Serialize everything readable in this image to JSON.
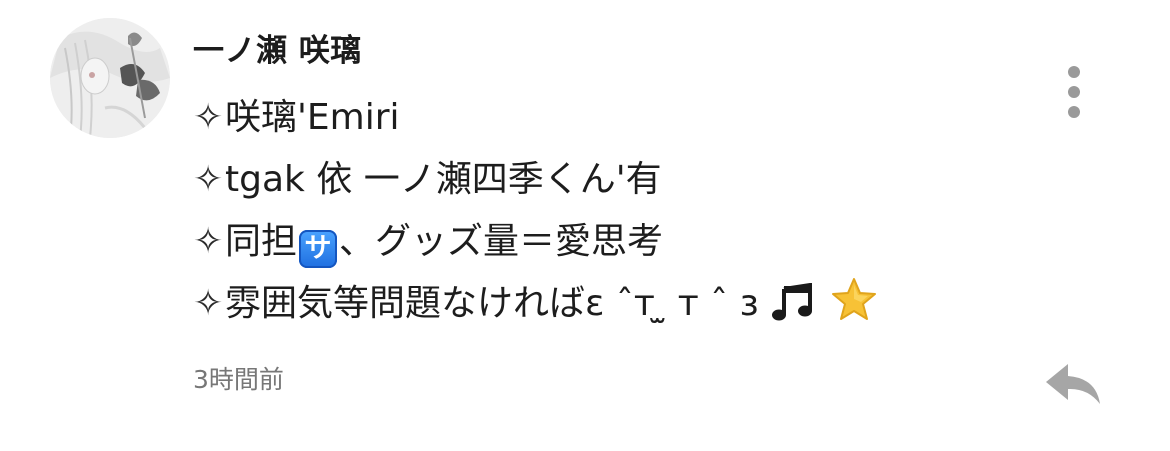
{
  "post": {
    "username": "一ノ瀬 咲璃",
    "bio_lines": [
      {
        "text": "咲璃'Emiri"
      },
      {
        "text": "tgak 依 一ノ瀬四季くん'有"
      },
      {
        "before_badge": "同担",
        "badge": "サ",
        "after_badge": "、グッズ量＝愛思考"
      },
      {
        "text": "雰囲気等問題なければε ˆт ̫ т ˆ з"
      }
    ],
    "bullet_glyph": "✧",
    "timestamp": "3時間前",
    "icons": {
      "avatar": "avatar-image",
      "more": "more-vertical-icon",
      "reply": "reply-arrow-icon",
      "music": "music-notes-icon",
      "star": "star-icon",
      "badge": "sa-button-icon"
    },
    "colors": {
      "text": "#1d1d1d",
      "muted": "#777777",
      "icon_gray": "#9a9a9a",
      "badge_blue": "#2b85f0",
      "star_yellow": "#f7c236"
    }
  }
}
